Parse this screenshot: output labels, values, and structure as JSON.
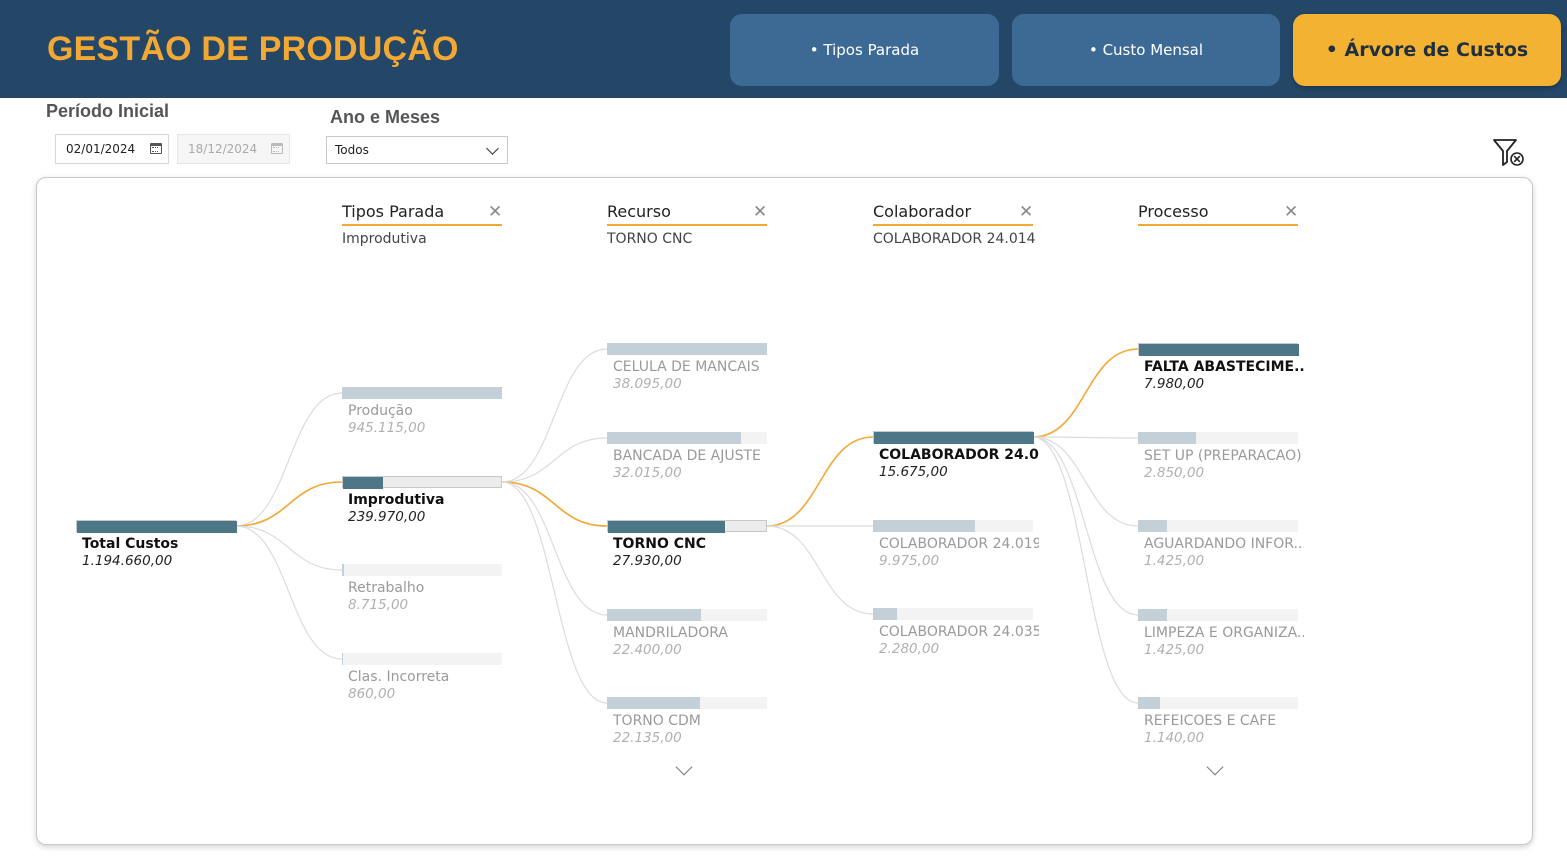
{
  "header": {
    "title": "GESTÃO DE PRODUÇÃO",
    "nav": [
      {
        "label": "• Tipos Parada",
        "active": false
      },
      {
        "label": "• Custo Mensal",
        "active": false
      },
      {
        "label": "• Árvore de Custos",
        "active": true
      }
    ]
  },
  "filters": {
    "periodo_label": "Período Inicial",
    "date_start": "02/01/2024",
    "date_end": "18/12/2024",
    "ano_meses_label": "Ano e Meses",
    "ano_meses_value": "Todos"
  },
  "tree": {
    "root": {
      "label": "Total Custos",
      "value": "1.194.660,00",
      "fill_fraction": 1.0
    },
    "levels": [
      {
        "header": "Tipos Parada",
        "selected": "Improdutiva",
        "nodes": [
          {
            "label": "Produção",
            "value": "945.115,00",
            "fill_fraction": 1.0,
            "selected": false
          },
          {
            "label": "Improdutiva",
            "value": "239.970,00",
            "fill_fraction": 0.25,
            "selected": true
          },
          {
            "label": "Retrabalho",
            "value": "8.715,00",
            "fill_fraction": 0.01,
            "selected": false
          },
          {
            "label": "Clas. Incorreta",
            "value": "860,00",
            "fill_fraction": 0.0,
            "selected": false
          }
        ]
      },
      {
        "header": "Recurso",
        "selected": "TORNO CNC",
        "nodes": [
          {
            "label": "CELULA DE MANCAIS",
            "value": "38.095,00",
            "fill_fraction": 1.0,
            "selected": false
          },
          {
            "label": "BANCADA DE AJUSTE",
            "value": "32.015,00",
            "fill_fraction": 0.84,
            "selected": false
          },
          {
            "label": "TORNO CNC",
            "value": "27.930,00",
            "fill_fraction": 0.73,
            "selected": true
          },
          {
            "label": "MANDRILADORA",
            "value": "22.400,00",
            "fill_fraction": 0.59,
            "selected": false
          },
          {
            "label": "TORNO CDM",
            "value": "22.135,00",
            "fill_fraction": 0.58,
            "selected": false
          }
        ],
        "has_more": true
      },
      {
        "header": "Colaborador",
        "selected": "COLABORADOR 24.014",
        "nodes": [
          {
            "label": "COLABORADOR 24.0...",
            "value": "15.675,00",
            "fill_fraction": 1.0,
            "selected": true
          },
          {
            "label": "COLABORADOR 24.019",
            "value": "9.975,00",
            "fill_fraction": 0.64,
            "selected": false
          },
          {
            "label": "COLABORADOR 24.035",
            "value": "2.280,00",
            "fill_fraction": 0.15,
            "selected": false
          }
        ]
      },
      {
        "header": "Processo",
        "selected": "",
        "nodes": [
          {
            "label": "FALTA ABASTECIME...",
            "value": "7.980,00",
            "fill_fraction": 1.0,
            "selected": true
          },
          {
            "label": "SET UP (PREPARACAO)",
            "value": "2.850,00",
            "fill_fraction": 0.36,
            "selected": false
          },
          {
            "label": "AGUARDANDO INFOR...",
            "value": "1.425,00",
            "fill_fraction": 0.18,
            "selected": false
          },
          {
            "label": "LIMPEZA E ORGANIZA...",
            "value": "1.425,00",
            "fill_fraction": 0.18,
            "selected": false
          },
          {
            "label": "REFEICOES E CAFE",
            "value": "1.140,00",
            "fill_fraction": 0.14,
            "selected": false
          }
        ],
        "has_more": true
      }
    ]
  },
  "colors": {
    "header_bg": "#244768",
    "title": "#f3a833",
    "nav_inactive": "#3d6a94",
    "nav_active": "#f3b232",
    "selected_bar": "#4b7787",
    "unselected_bar": "#c3d0d8",
    "path_highlight": "#f3a833",
    "path_default": "#dcdcdc"
  }
}
